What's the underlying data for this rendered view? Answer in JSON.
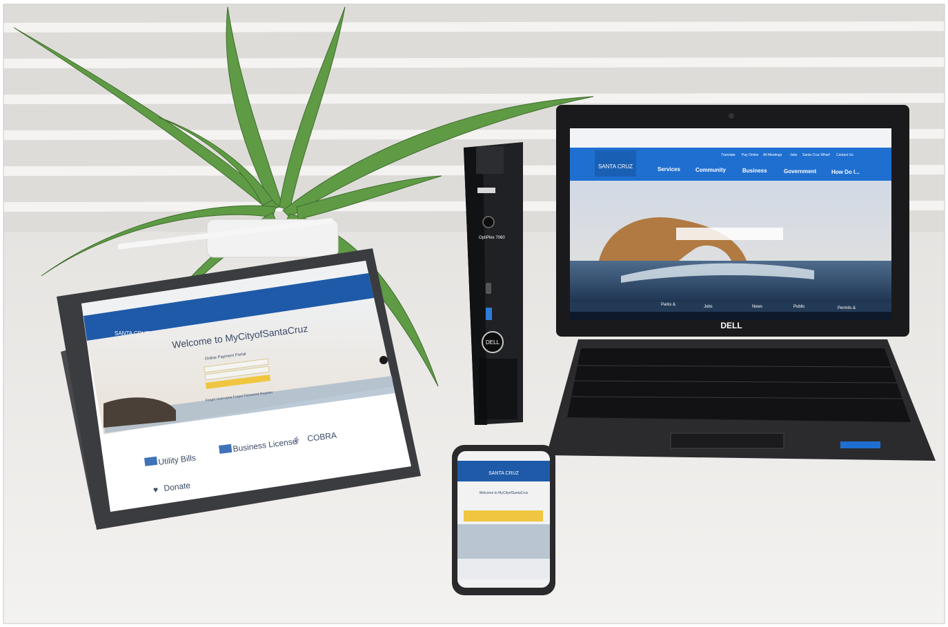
{
  "laptop": {
    "brand": "DELL",
    "site_nav": [
      "Services",
      "Community",
      "Business",
      "Government",
      "How Do I..."
    ],
    "site_top_links": [
      "Translate",
      "Pay Online",
      "All Meetings",
      "Jobs",
      "Santa Cruz Wharf",
      "Contact Us"
    ],
    "taskbar_items": [
      "Parks &",
      "Jobs",
      "News",
      "Public",
      "Permits &"
    ]
  },
  "minipc": {
    "brand": "DELL",
    "model": "OptiPlex 7060"
  },
  "tablet": {
    "logo_text": "SANTA CRUZ",
    "welcome": "Welcome to MyCityofSantaCruz",
    "subtitle": "Online Payment Portal",
    "forgot": "Forgot Username  Forgot Password  Register",
    "links": {
      "utility": "Utility Bills",
      "business": "Business License",
      "cobra": "COBRA",
      "donate": "Donate"
    }
  },
  "phone": {
    "logo_text": "SANTA CRUZ",
    "welcome": "Welcome to MyCityofSantaCruz"
  }
}
